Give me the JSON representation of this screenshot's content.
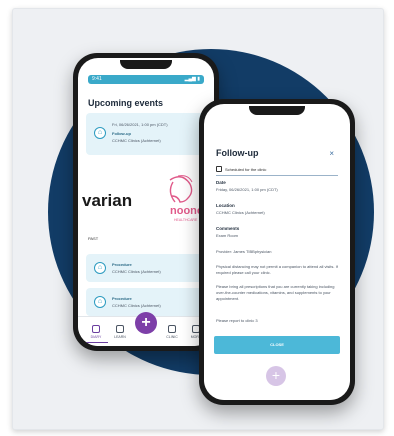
{
  "back_phone": {
    "status_time": "9:41",
    "status_right": "▂▄▆ ▮",
    "upcoming_title": "Upcoming events",
    "event_top": {
      "date": "Fri, 06/26/2021, 1:00 pm (CDT)",
      "type": "Follow-up",
      "location": "CCHMC Clinics (Achternet)"
    },
    "logo_text": "varian",
    "logo_text_pink": "noono",
    "logo_subtext": "HEALTHCARE",
    "past_label": "PAST",
    "event_past_1": {
      "type": "Procedure",
      "location": "CCHMC Clinics (Achternet)"
    },
    "event_past_2": {
      "type": "Procedure",
      "location": "CCHMC Clinics (Achternet)"
    },
    "tabs": [
      {
        "label": "DIARY"
      },
      {
        "label": "LEARN"
      },
      {
        "label": "+"
      },
      {
        "label": "CLINIC"
      },
      {
        "label": "MORE"
      }
    ]
  },
  "front_phone": {
    "title": "Follow-up",
    "close": "×",
    "scheduled_label": "Scheduled for the clinic",
    "date_heading": "Date",
    "date_value": "Friday, 06/26/2021, 1:00 pm (CDT)",
    "location_heading": "Location",
    "location_value": "CCHMC Clinics (Achternet)",
    "comments_heading": "Comments",
    "comments_value": "Exam Room",
    "provider": "Provider: James TIBBphysician",
    "note_1": "Physical distancing may not permit a companion to attend all visits. If required please call your clinic.",
    "note_2": "Please bring all prescriptions that you are currently taking including over-the-counter medications, vitamins, and supplements to your appointment.",
    "note_3": "Please report to clinic 3",
    "button_label": "CLOSE"
  },
  "colors": {
    "circle": "#123c66",
    "accent_blue": "#4cb8d8",
    "accent_purple": "#7d3fa8",
    "card_tint": "#e4f3f9"
  }
}
